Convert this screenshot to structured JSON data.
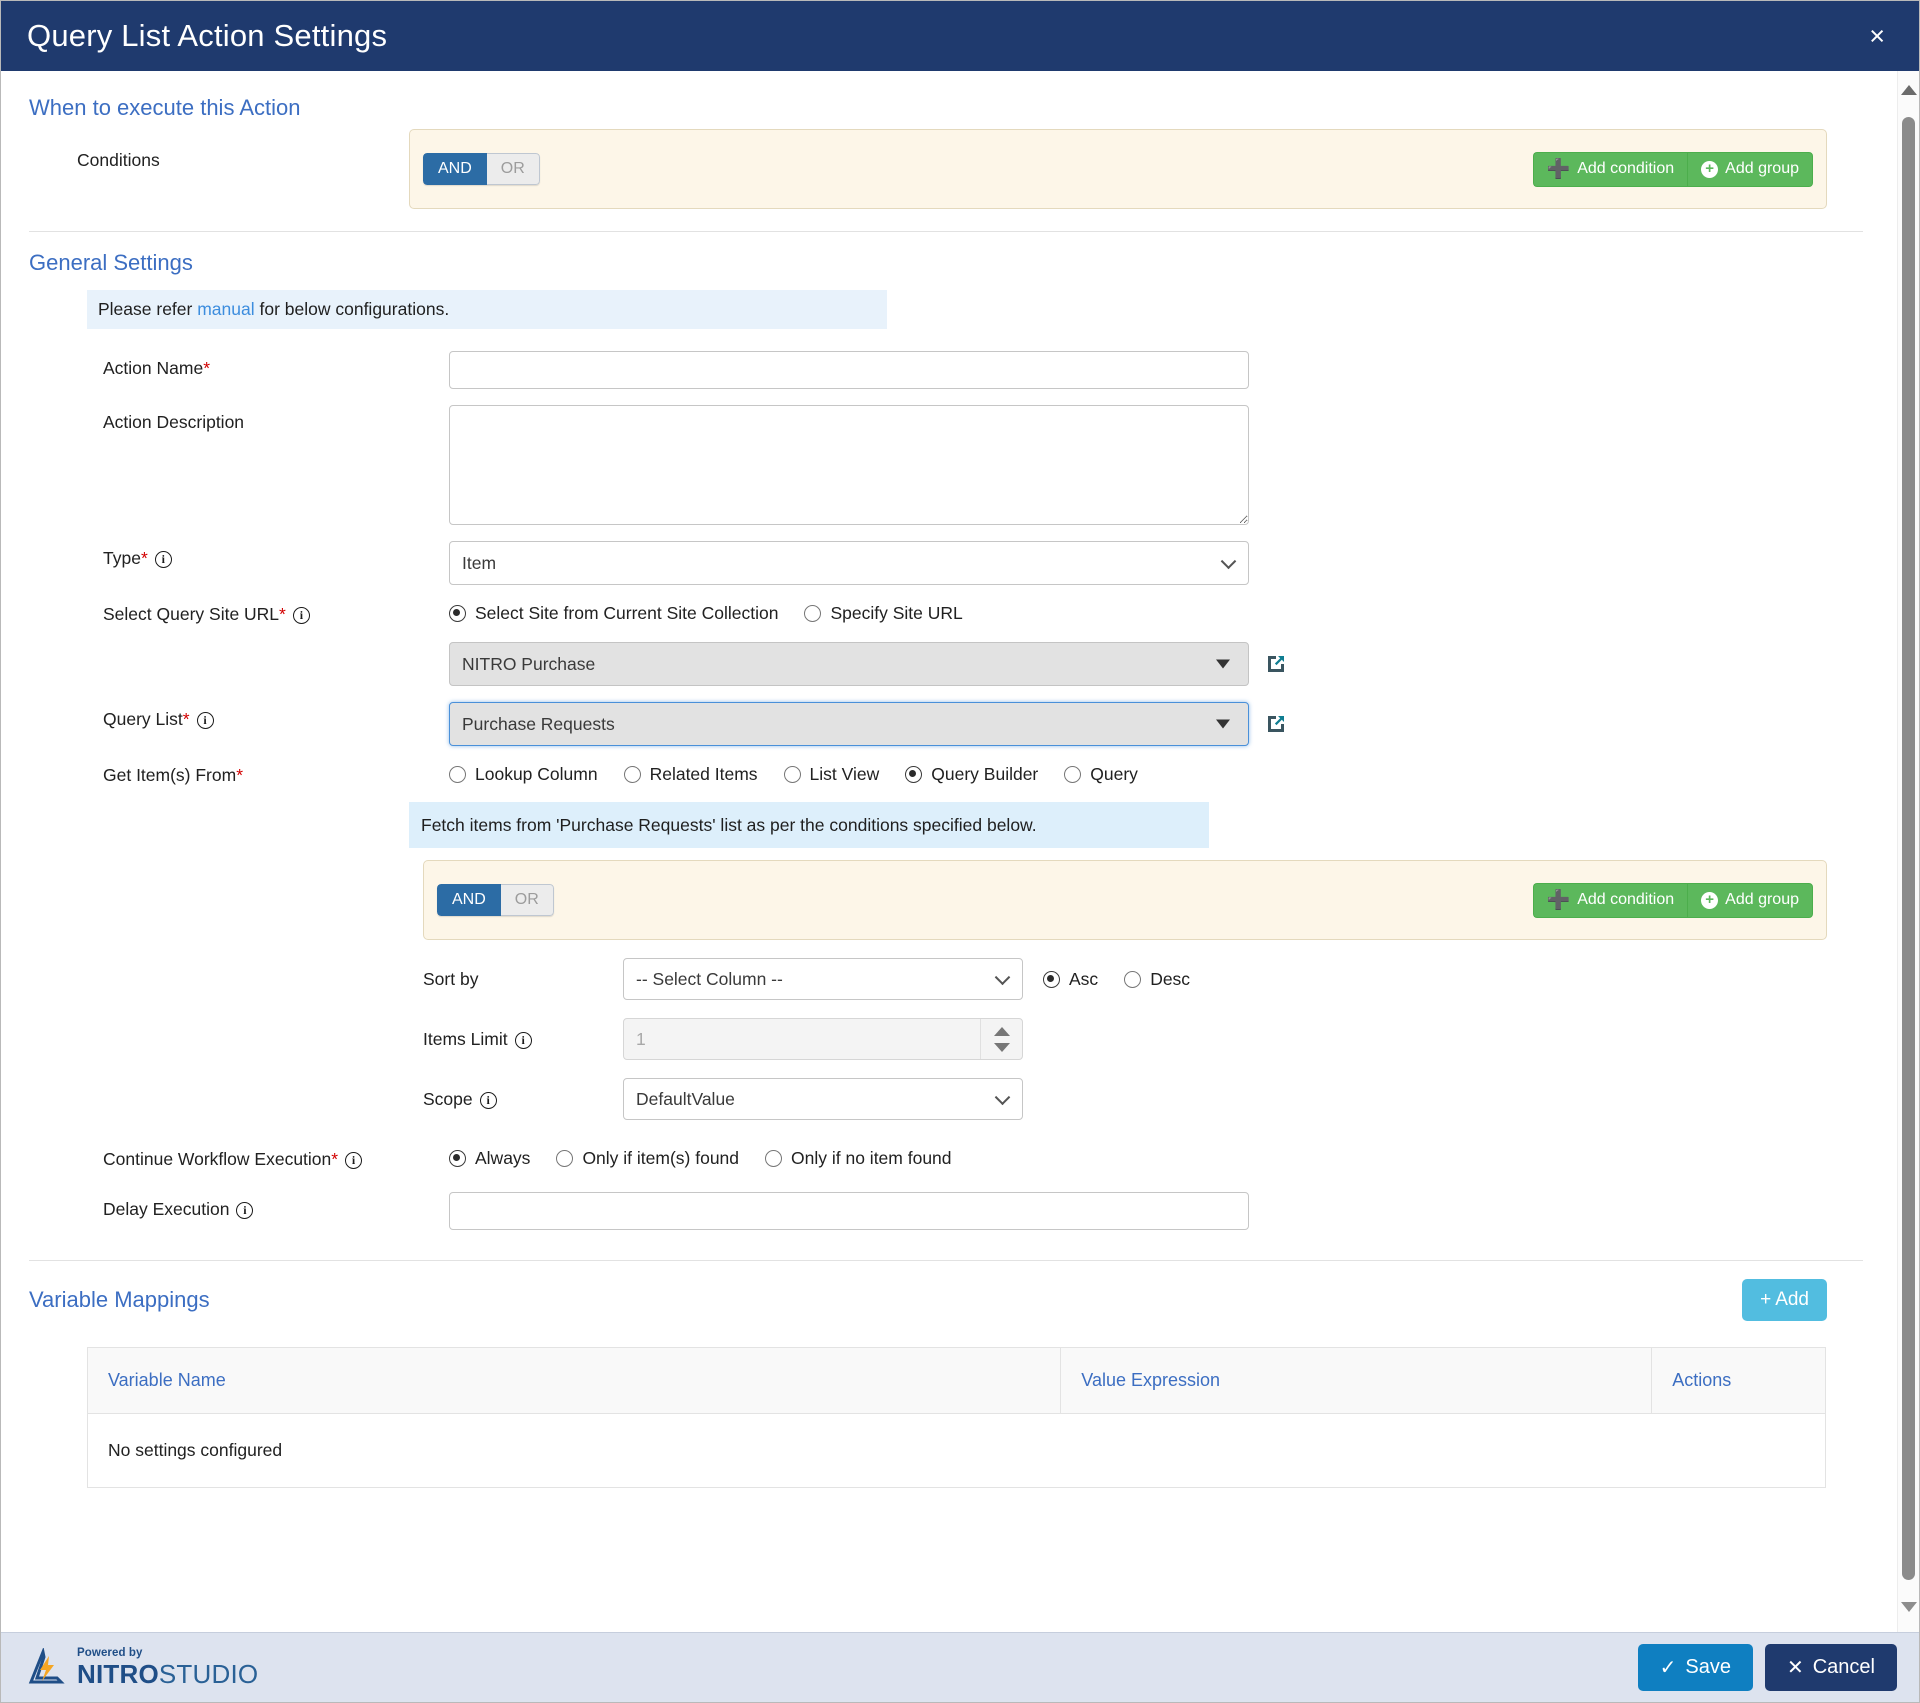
{
  "dialog": {
    "title": "Query List Action Settings",
    "close_label": "×"
  },
  "when_section": {
    "heading": "When to execute this Action",
    "conditions_label": "Conditions",
    "and_label": "AND",
    "or_label": "OR",
    "add_condition_label": "Add condition",
    "add_group_label": "Add group"
  },
  "general": {
    "heading": "General Settings",
    "note_prefix": "Please refer ",
    "note_link": "manual",
    "note_suffix": " for below configurations.",
    "action_name_label": "Action Name",
    "action_name_value": "",
    "action_description_label": "Action Description",
    "action_description_value": "",
    "type_label": "Type",
    "type_value": "Item",
    "site_url_label": "Select Query Site URL",
    "site_opt_current": "Select Site from Current Site Collection",
    "site_opt_specify": "Specify Site URL",
    "site_value": "NITRO Purchase",
    "query_list_label": "Query List",
    "query_list_value": "Purchase Requests",
    "get_items_label": "Get Item(s) From",
    "get_items_options": [
      "Lookup Column",
      "Related Items",
      "List View",
      "Query Builder",
      "Query"
    ],
    "get_items_selected": "Query Builder",
    "query_builder_note": "Fetch items from 'Purchase Requests' list as per the conditions specified below.",
    "qb_and_label": "AND",
    "qb_or_label": "OR",
    "qb_add_condition_label": "Add condition",
    "qb_add_group_label": "Add group",
    "sort_by_label": "Sort by",
    "sort_by_value": "-- Select Column --",
    "sort_asc_label": "Asc",
    "sort_desc_label": "Desc",
    "items_limit_label": "Items Limit",
    "items_limit_value": "1",
    "scope_label": "Scope",
    "scope_value": "DefaultValue",
    "continue_label": "Continue Workflow Execution",
    "continue_options": [
      "Always",
      "Only if item(s) found",
      "Only if no item found"
    ],
    "continue_selected": "Always",
    "delay_label": "Delay Execution",
    "delay_value": ""
  },
  "variable_mappings": {
    "heading": "Variable Mappings",
    "add_label": "Add",
    "columns": [
      "Variable Name",
      "Value Expression",
      "Actions"
    ],
    "empty_text": "No settings configured"
  },
  "footer": {
    "logo_powered": "Powered by",
    "logo_nitro": "NITRO",
    "logo_studio": "STUDIO",
    "save_label": "Save",
    "cancel_label": "Cancel"
  },
  "colors": {
    "header_bg": "#1f3a6e",
    "accent_link": "#3c6ec2",
    "green_btn": "#5cb85c",
    "add_btn": "#52bde0",
    "save_btn": "#0f7fc1",
    "cancel_btn": "#1f3a6e",
    "cond_panel_bg": "#fdf6e8",
    "note_bg": "#e8f2fb",
    "qb_note_bg": "#ddeffb",
    "required_star": "#d20000"
  }
}
